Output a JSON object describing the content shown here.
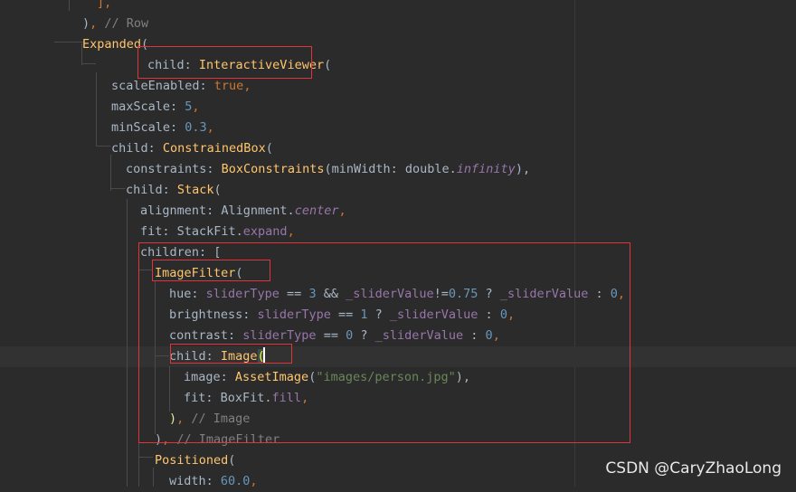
{
  "editor": {
    "lines": [
      [
        {
          "t": "],",
          "c": "punc"
        }
      ],
      [
        {
          "t": ")",
          "c": "plain"
        },
        {
          "t": ", ",
          "c": "punc"
        },
        {
          "t": "// Row",
          "c": "comment"
        }
      ],
      [
        {
          "t": "Expanded",
          "c": "class"
        },
        {
          "t": "(",
          "c": "plain"
        }
      ],
      [
        {
          "t": "child: ",
          "c": "plain"
        },
        {
          "t": "InteractiveViewer",
          "c": "class"
        },
        {
          "t": "(",
          "c": "plain"
        }
      ],
      [
        {
          "t": "scaleEnabled: ",
          "c": "plain"
        },
        {
          "t": "true",
          "c": "kw"
        },
        {
          "t": ",",
          "c": "punc"
        }
      ],
      [
        {
          "t": "maxScale: ",
          "c": "plain"
        },
        {
          "t": "5",
          "c": "num"
        },
        {
          "t": ",",
          "c": "punc"
        }
      ],
      [
        {
          "t": "minScale: ",
          "c": "plain"
        },
        {
          "t": "0.3",
          "c": "num"
        },
        {
          "t": ",",
          "c": "punc"
        }
      ],
      [
        {
          "t": "child: ",
          "c": "plain"
        },
        {
          "t": "ConstrainedBox",
          "c": "class"
        },
        {
          "t": "(",
          "c": "plain"
        }
      ],
      [
        {
          "t": "constraints: ",
          "c": "plain"
        },
        {
          "t": "BoxConstraints",
          "c": "class"
        },
        {
          "t": "(minWidth: double.",
          "c": "plain"
        },
        {
          "t": "infinity",
          "c": "italic"
        },
        {
          "t": "),",
          "c": "plain"
        }
      ],
      [
        {
          "t": "child: ",
          "c": "plain"
        },
        {
          "t": "Stack",
          "c": "class"
        },
        {
          "t": "(",
          "c": "plain"
        }
      ],
      [
        {
          "t": "alignment: Alignment.",
          "c": "plain"
        },
        {
          "t": "center",
          "c": "italic"
        },
        {
          "t": ",",
          "c": "punc"
        }
      ],
      [
        {
          "t": "fit: StackFit.",
          "c": "plain"
        },
        {
          "t": "expand",
          "c": "field"
        },
        {
          "t": ",",
          "c": "punc"
        }
      ],
      [
        {
          "t": "children: [",
          "c": "plain"
        }
      ],
      [
        {
          "t": "ImageFilter",
          "c": "class"
        },
        {
          "t": "(",
          "c": "plain"
        }
      ],
      [
        {
          "t": "hue: ",
          "c": "plain"
        },
        {
          "t": "sliderType",
          "c": "field"
        },
        {
          "t": " == ",
          "c": "plain"
        },
        {
          "t": "3",
          "c": "num"
        },
        {
          "t": " && ",
          "c": "plain"
        },
        {
          "t": "_sliderValue",
          "c": "field"
        },
        {
          "t": "!=",
          "c": "plain"
        },
        {
          "t": "0.75",
          "c": "num"
        },
        {
          "t": " ? ",
          "c": "plain"
        },
        {
          "t": "_sliderValue",
          "c": "field"
        },
        {
          "t": " : ",
          "c": "plain"
        },
        {
          "t": "0",
          "c": "num"
        },
        {
          "t": ",",
          "c": "punc"
        }
      ],
      [
        {
          "t": "brightness: ",
          "c": "plain"
        },
        {
          "t": "sliderType",
          "c": "field"
        },
        {
          "t": " == ",
          "c": "plain"
        },
        {
          "t": "1",
          "c": "num"
        },
        {
          "t": " ? ",
          "c": "plain"
        },
        {
          "t": "_sliderValue",
          "c": "field"
        },
        {
          "t": " : ",
          "c": "plain"
        },
        {
          "t": "0",
          "c": "num"
        },
        {
          "t": ",",
          "c": "punc"
        }
      ],
      [
        {
          "t": "contrast: ",
          "c": "plain"
        },
        {
          "t": "sliderType",
          "c": "field"
        },
        {
          "t": " == ",
          "c": "plain"
        },
        {
          "t": "0",
          "c": "num"
        },
        {
          "t": " ? ",
          "c": "plain"
        },
        {
          "t": "_sliderValue",
          "c": "field"
        },
        {
          "t": " : ",
          "c": "plain"
        },
        {
          "t": "0",
          "c": "num"
        },
        {
          "t": ",",
          "c": "punc"
        }
      ],
      [
        {
          "t": "child: ",
          "c": "plain"
        },
        {
          "t": "Image",
          "c": "class"
        },
        {
          "t": "(",
          "c": "paren-hl"
        }
      ],
      [
        {
          "t": "image: ",
          "c": "plain"
        },
        {
          "t": "AssetImage",
          "c": "class"
        },
        {
          "t": "(",
          "c": "plain"
        },
        {
          "t": "\"images/person.jpg\"",
          "c": "str"
        },
        {
          "t": "),",
          "c": "plain"
        }
      ],
      [
        {
          "t": "fit: BoxFit.",
          "c": "plain"
        },
        {
          "t": "fill",
          "c": "field"
        },
        {
          "t": ",",
          "c": "punc"
        }
      ],
      [
        {
          "t": ")",
          "c": "paren-yel"
        },
        {
          "t": ", ",
          "c": "punc"
        },
        {
          "t": "// Image",
          "c": "comment"
        }
      ],
      [
        {
          "t": ")",
          "c": "plain"
        },
        {
          "t": ", ",
          "c": "punc"
        },
        {
          "t": "// ImageFilter",
          "c": "comment"
        }
      ],
      [
        {
          "t": "Positioned",
          "c": "class"
        },
        {
          "t": "(",
          "c": "plain"
        }
      ],
      [
        {
          "t": "width: ",
          "c": "plain"
        },
        {
          "t": "60.0",
          "c": "num"
        },
        {
          "t": ",",
          "c": "punc"
        }
      ]
    ]
  },
  "colors": {
    "background": "#2b2b2b",
    "highlight_box": "#e0343a"
  },
  "watermark": "CSDN @CaryZhaoLong"
}
